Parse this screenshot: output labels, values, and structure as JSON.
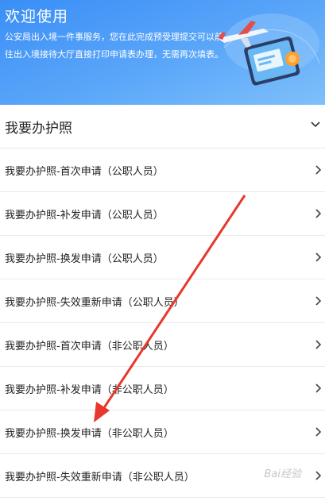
{
  "banner": {
    "title": "欢迎使用",
    "description": "公安局出入境一件事服务，您在此完成预受理提交可以前往出入境接待大厅直接打印申请表办理，无需再次填表。"
  },
  "section": {
    "title": "我要办护照"
  },
  "items": [
    {
      "label": "我要办护照-首次申请（公职人员）"
    },
    {
      "label": "我要办护照-补发申请（公职人员）"
    },
    {
      "label": "我要办护照-换发申请（公职人员）"
    },
    {
      "label": "我要办护照-失效重新申请（公职人员）"
    },
    {
      "label": "我要办护照-首次申请（非公职人员）"
    },
    {
      "label": "我要办护照-补发申请（非公职人员）"
    },
    {
      "label": "我要办护照-换发申请（非公职人员）"
    },
    {
      "label": "我要办护照-失效重新申请（非公职人员）"
    }
  ],
  "annotation": {
    "color": "#e8372d"
  },
  "watermark": {
    "text": "Bai经验"
  }
}
